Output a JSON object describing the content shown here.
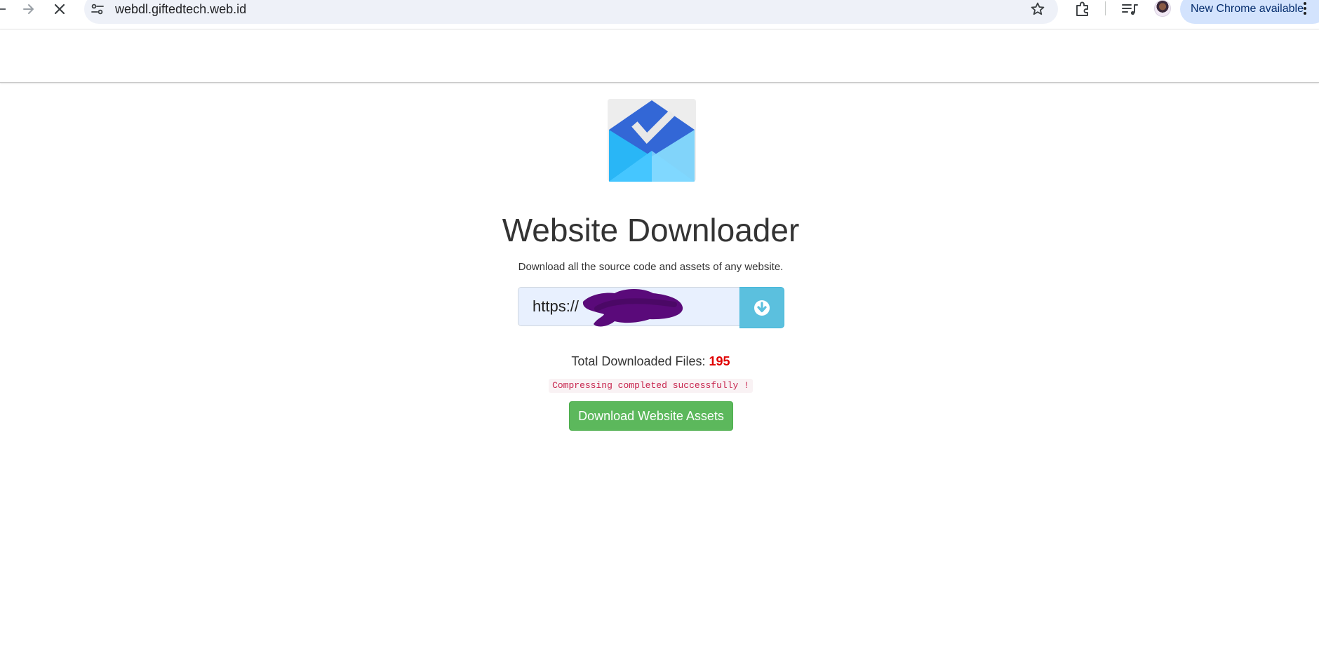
{
  "browser": {
    "url": "webdl.giftedtech.web.id",
    "update_label": "New Chrome available",
    "icons": {
      "back": "arrow-left-icon",
      "forward": "arrow-right-icon",
      "stop": "close-icon",
      "site_info": "tune-icon",
      "bookmark": "star-icon",
      "extensions": "puzzle-icon",
      "media": "queue-music-icon",
      "menu": "more-vert-icon"
    },
    "colors": {
      "omnibox_bg": "#eef1f8",
      "update_pill_bg": "#d3e3fd"
    }
  },
  "main": {
    "title": "Website Downloader",
    "subtitle": "Download all the source code and assets of any website.",
    "url_input_value": "https://",
    "submit_icon": "download-circle-icon",
    "count_label": "Total Downloaded Files:",
    "count_value": "195",
    "status_message": "Compressing completed successfully !",
    "download_button": "Download Website Assets",
    "colors": {
      "submit_button": "#5bc0de",
      "download_button": "#5cb85c",
      "count_value": "#e00000",
      "status_text": "#c7254e",
      "redaction_scribble": "#5a0a7a"
    }
  }
}
